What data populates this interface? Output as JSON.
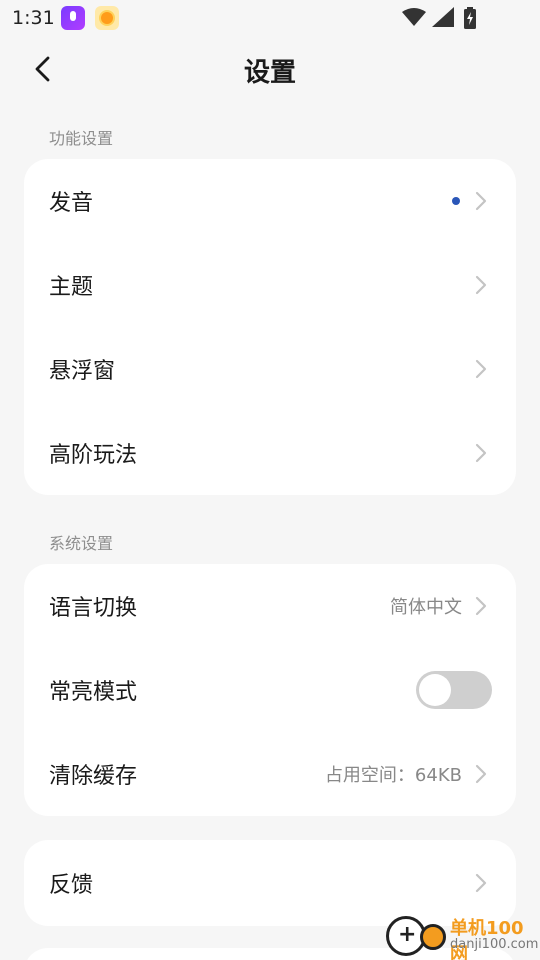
{
  "status_bar": {
    "time": "1:31",
    "icons": [
      "voice-app-icon",
      "weather-app-icon",
      "wifi-icon",
      "cellular-signal-icon",
      "battery-charging-icon"
    ]
  },
  "header": {
    "title": "设置",
    "back_icon": "chevron-left-icon"
  },
  "sections": {
    "function": {
      "label": "功能设置",
      "items": [
        {
          "label": "发音",
          "has_dot": true
        },
        {
          "label": "主题"
        },
        {
          "label": "悬浮窗"
        },
        {
          "label": "高阶玩法"
        }
      ]
    },
    "system": {
      "label": "系统设置",
      "items": [
        {
          "label": "语言切换",
          "value": "简体中文"
        },
        {
          "label": "常亮模式",
          "toggle_on": false
        },
        {
          "label": "清除缓存",
          "value": "占用空间：64KB"
        }
      ]
    },
    "feedback": {
      "items": [
        {
          "label": "反馈"
        }
      ]
    }
  },
  "watermark": {
    "title": "单机100网",
    "url": "danji100.com"
  },
  "colors": {
    "background": "#f6f6f6",
    "card": "#ffffff",
    "accent_dot": "#2a56b8",
    "toggle_off": "#cfcfcf",
    "watermark_orange": "#f39c1f"
  }
}
